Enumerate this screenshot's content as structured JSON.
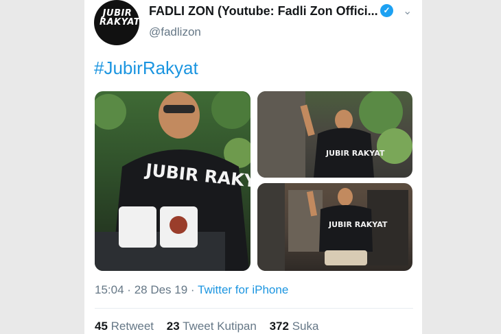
{
  "author": {
    "display_name": "FADLI ZON (Youtube: Fadli Zon Offici...",
    "handle": "@fadlizon",
    "avatar_text": "JUBIR RAKYAT",
    "verified_icon": "verified-check-icon"
  },
  "tweet": {
    "text": "#JubirRakyat",
    "photos": [
      {
        "shirt_text": "JUBIR RAKYAT"
      },
      {
        "shirt_text": "JUBIR RAKYAT"
      },
      {
        "shirt_text": "JUBIR RAKYAT"
      }
    ],
    "time": "15:04",
    "separator": "·",
    "date": "28 Des 19",
    "source": "Twitter for iPhone"
  },
  "stats": {
    "retweets_count": "45",
    "retweets_label": "Retweet",
    "quotes_count": "23",
    "quotes_label": "Tweet Kutipan",
    "likes_count": "372",
    "likes_label": "Suka"
  },
  "colors": {
    "accent": "#1b95e0",
    "verified": "#1da1f2",
    "muted": "#657786"
  }
}
